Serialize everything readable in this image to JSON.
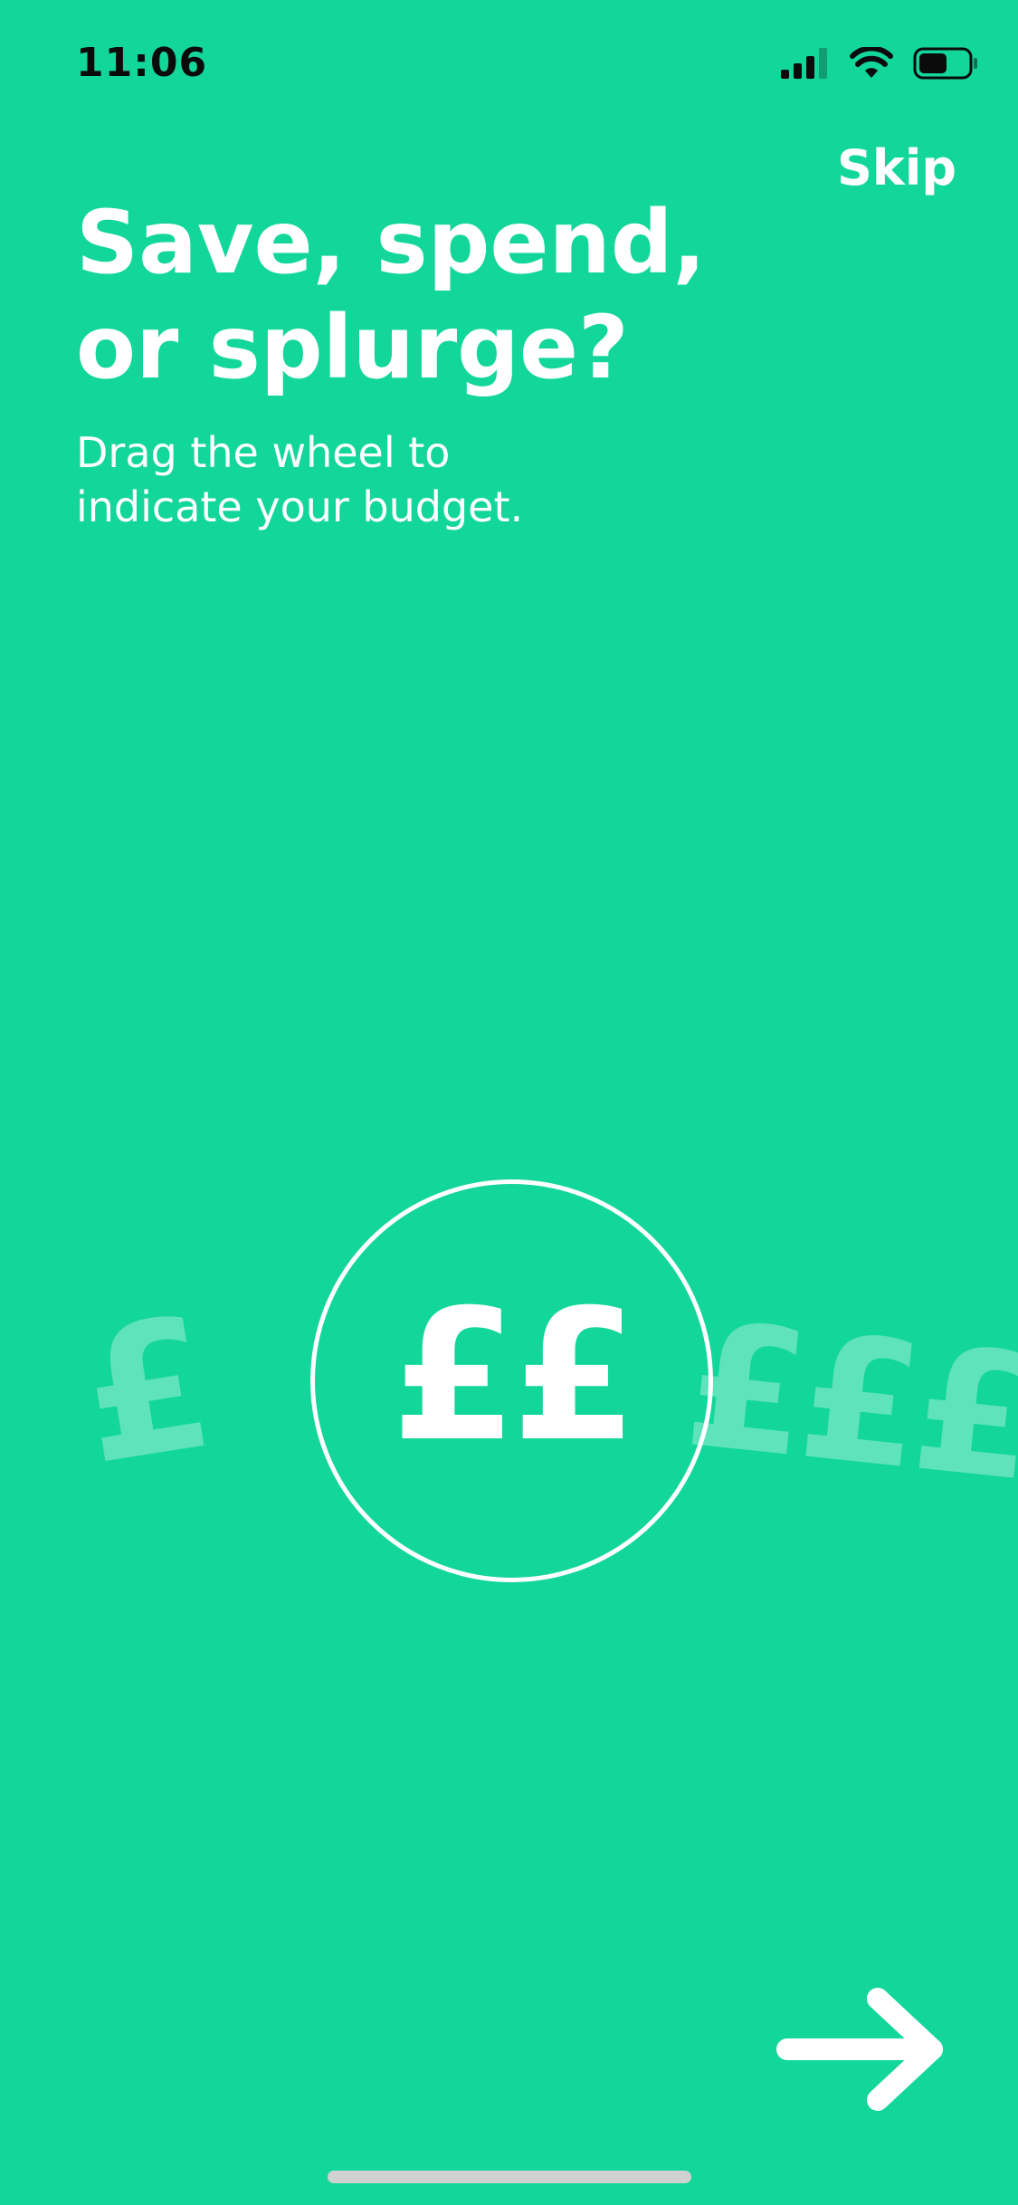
{
  "status_bar": {
    "time": "11:06",
    "icons": [
      "cellular-signal-icon",
      "wifi-icon",
      "battery-icon"
    ]
  },
  "header": {
    "skip_label": "Skip"
  },
  "main": {
    "title": "Save, spend,\nor splurge?",
    "subtitle": "Drag the wheel to\nindicate your budget."
  },
  "budget_wheel": {
    "options": [
      "£",
      "££",
      "£££"
    ],
    "selected_value": "££",
    "previous_option": "£",
    "next_option": "£££"
  },
  "footer": {
    "next_icon": "arrow-right-icon"
  },
  "colors": {
    "background": "#13d69a",
    "foreground": "#ffffff",
    "status_text": "#0b0b0b",
    "faded_option": "rgba(255,255,255,0.32)",
    "home_indicator": "#cfd2d0"
  }
}
